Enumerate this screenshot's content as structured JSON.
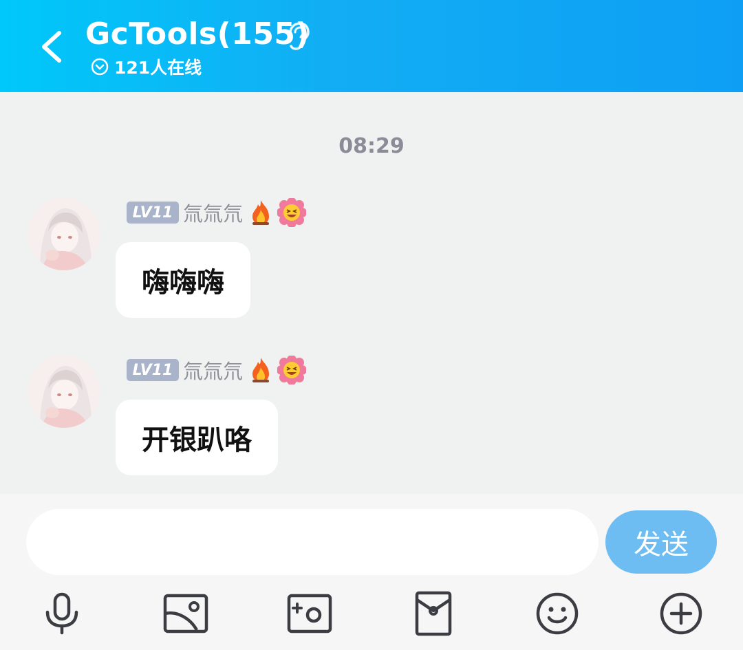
{
  "header": {
    "title": "GcTools(155)",
    "online_text": "121人在线",
    "background_gradient": [
      "#00c8fa",
      "#0e9ff4"
    ]
  },
  "chat": {
    "time_divider": "08:29",
    "messages": [
      {
        "level": "LV11",
        "sender": "氚氚氘",
        "badges": [
          "fire-emoji",
          "laughing-flower-emoji"
        ],
        "text": "嗨嗨嗨"
      },
      {
        "level": "LV11",
        "sender": "氚氚氘",
        "badges": [
          "fire-emoji",
          "laughing-flower-emoji"
        ],
        "text": "开银趴咯"
      }
    ]
  },
  "input_bar": {
    "input_value": "",
    "send_label": "发送",
    "send_color": "#6dbdf3",
    "toolbar": [
      "microphone-icon",
      "image-icon",
      "camera-icon",
      "red-packet-icon",
      "emoji-icon",
      "plus-icon"
    ]
  }
}
